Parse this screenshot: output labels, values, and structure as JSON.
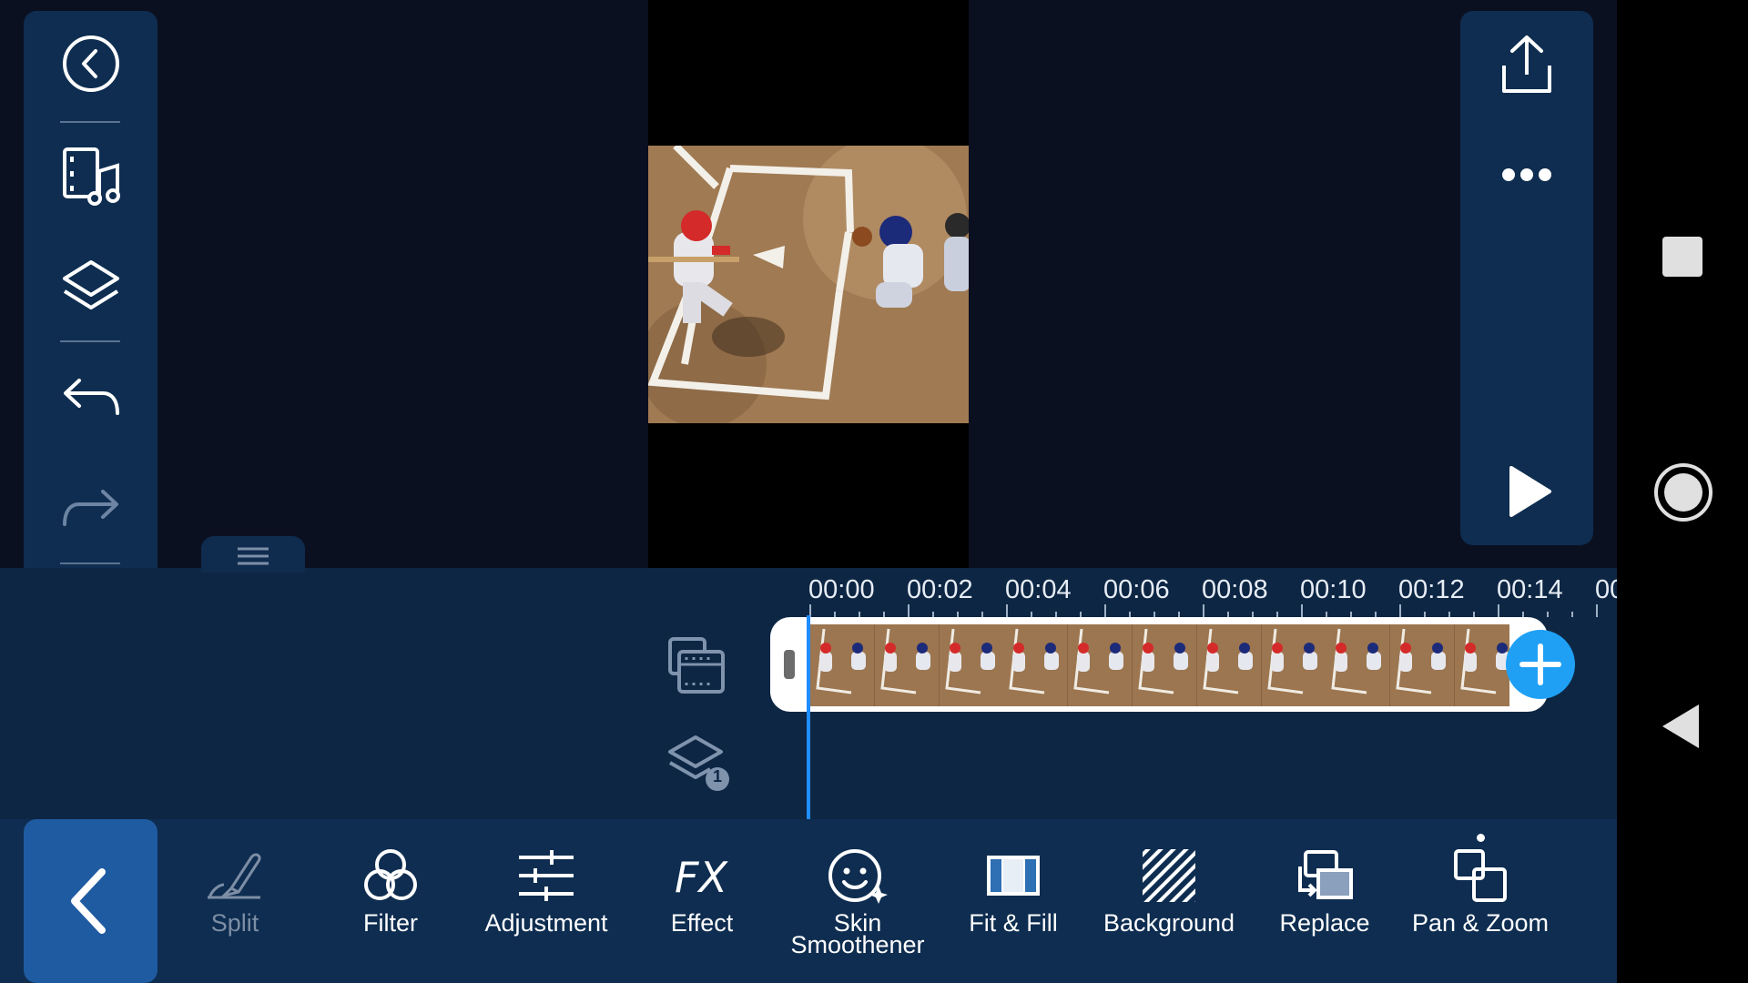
{
  "timeline": {
    "ticks": [
      "00:00",
      "00:02",
      "00:04",
      "00:06",
      "00:08",
      "00:10",
      "00:12",
      "00:14",
      "00"
    ],
    "layer_count": "1"
  },
  "tools": [
    {
      "label": "Split",
      "icon": "eraser-icon",
      "enabled": false
    },
    {
      "label": "Filter",
      "icon": "filter-circles-icon",
      "enabled": true
    },
    {
      "label": "Adjustment",
      "icon": "sliders-icon",
      "enabled": true
    },
    {
      "label": "Effect",
      "icon": "fx-icon",
      "enabled": true
    },
    {
      "label": "Skin Smoothener",
      "icon": "face-sparkle-icon",
      "enabled": true
    },
    {
      "label": "Fit & Fill",
      "icon": "fit-fill-icon",
      "enabled": true
    },
    {
      "label": "Background",
      "icon": "hatched-square-icon",
      "enabled": true
    },
    {
      "label": "Replace",
      "icon": "replace-icon",
      "enabled": true
    },
    {
      "label": "Pan & Zoom",
      "icon": "pan-zoom-icon",
      "enabled": true
    }
  ],
  "left_toolbar": {
    "icons": [
      "back-circle-icon",
      "media-library-icon",
      "layers-icon",
      "undo-icon",
      "redo-icon",
      "trash-icon"
    ],
    "redo_enabled": false
  },
  "right_panel": {
    "icons": [
      "export-icon",
      "more-icon",
      "play-icon"
    ]
  },
  "nav_bar": {
    "icons": [
      "recents-square-icon",
      "home-circle-icon",
      "back-triangle-icon"
    ]
  },
  "colors": {
    "accent": "#1f8cff",
    "add_button": "#1fa0f5",
    "panel": "#0e2d50",
    "back_button": "#1f5ba0"
  }
}
